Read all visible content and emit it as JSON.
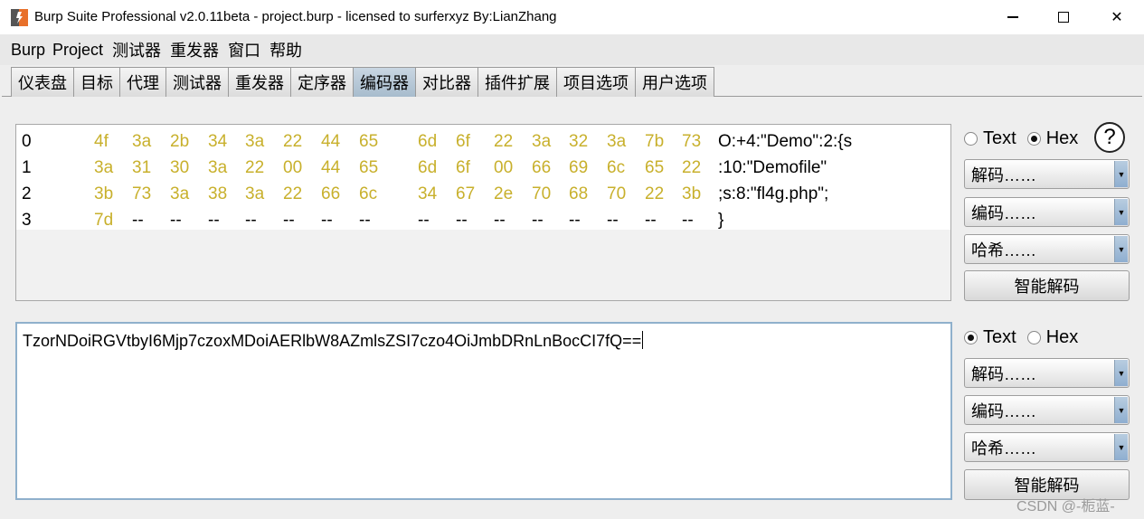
{
  "window": {
    "title": "Burp Suite Professional v2.0.11beta - project.burp - licensed to surferxyz By:LianZhang",
    "minimize_label": "",
    "maximize_label": "",
    "close_label": "✕"
  },
  "menu": {
    "items": [
      "Burp",
      "Project",
      "测试器",
      "重发器",
      "窗口",
      "帮助"
    ]
  },
  "tabs": {
    "items": [
      "仪表盘",
      "目标",
      "代理",
      "测试器",
      "重发器",
      "定序器",
      "编码器",
      "对比器",
      "插件扩展",
      "项目选项",
      "用户选项"
    ],
    "active": "编码器"
  },
  "hex_view": {
    "rows": [
      {
        "index": "0",
        "bytes": [
          "4f",
          "3a",
          "2b",
          "34",
          "3a",
          "22",
          "44",
          "65",
          "6d",
          "6f",
          "22",
          "3a",
          "32",
          "3a",
          "7b",
          "73"
        ],
        "ascii": "O:+4:\"Demo\":2:{s"
      },
      {
        "index": "1",
        "bytes": [
          "3a",
          "31",
          "30",
          "3a",
          "22",
          "00",
          "44",
          "65",
          "6d",
          "6f",
          "00",
          "66",
          "69",
          "6c",
          "65",
          "22"
        ],
        "ascii": ":10:\"Demofile\""
      },
      {
        "index": "2",
        "bytes": [
          "3b",
          "73",
          "3a",
          "38",
          "3a",
          "22",
          "66",
          "6c",
          "34",
          "67",
          "2e",
          "70",
          "68",
          "70",
          "22",
          "3b"
        ],
        "ascii": ";s:8:\"fl4g.php\";"
      },
      {
        "index": "3",
        "bytes": [
          "7d",
          "--",
          "--",
          "--",
          "--",
          "--",
          "--",
          "--",
          "--",
          "--",
          "--",
          "--",
          "--",
          "--",
          "--",
          "--"
        ],
        "ascii": "}"
      }
    ]
  },
  "text_view": {
    "value": "TzorNDoiRGVtbyI6Mjp7czoxMDoiAERlbW8AZmlsZSI7czo4OiJmbDRnLnBocCI7fQ=="
  },
  "controls_top": {
    "text_radio": "Text",
    "hex_radio": "Hex",
    "selected": "Hex",
    "help": "?",
    "decode": "解码……",
    "encode": "编码……",
    "hash": "哈希……",
    "smart_decode": "智能解码"
  },
  "controls_bottom": {
    "text_radio": "Text",
    "hex_radio": "Hex",
    "selected": "Text",
    "decode": "解码……",
    "encode": "编码……",
    "hash": "哈希……",
    "smart_decode": "智能解码"
  },
  "watermark": "CSDN @-栀蓝-",
  "colors": {
    "hex_byte": "#c8b02c",
    "active_tab": "#a7bccd",
    "text_panel_border": "#8fb0cc"
  }
}
